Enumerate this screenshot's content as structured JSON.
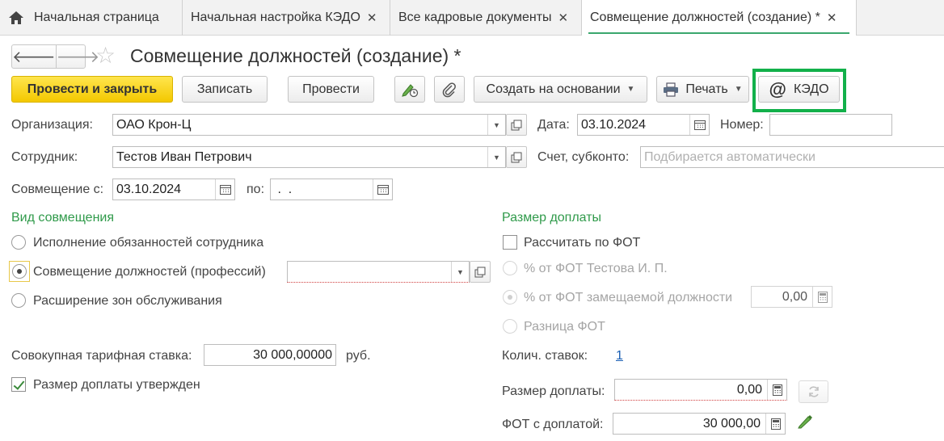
{
  "tabs": [
    {
      "label": "Начальная страница",
      "home": true
    },
    {
      "label": "Начальная настройка КЭДО"
    },
    {
      "label": "Все кадровые документы"
    },
    {
      "label": "Совмещение должностей (создание) *",
      "active": true
    }
  ],
  "header": {
    "title": "Совмещение должностей (создание) *"
  },
  "toolbar": {
    "post_close": "Провести и закрыть",
    "save": "Записать",
    "post": "Провести",
    "create_based": "Создать на основании",
    "print": "Печать",
    "kedo": "КЭДО"
  },
  "form": {
    "org_label": "Организация:",
    "org_value": "ОАО Крон-Ц",
    "date_label": "Дата:",
    "date_value": "03.10.2024",
    "number_label": "Номер:",
    "number_value": "",
    "employee_label": "Сотрудник:",
    "employee_value": "Тестов Иван Петрович",
    "account_label": "Счет, субконто:",
    "account_placeholder": "Подбирается автоматически",
    "from_label": "Совмещение с:",
    "from_value": "03.10.2024",
    "to_label": "по:",
    "to_value": " .  .",
    "kind_title": "Вид совмещения",
    "kind_options": [
      "Исполнение обязанностей сотрудника",
      "Совмещение должностей (профессий)",
      "Расширение зон обслуживания"
    ],
    "kind_selected": 1,
    "position_value": "",
    "rate_label": "Совокупная тарифная ставка:",
    "rate_value": "30 000,00000",
    "rate_unit": "руб.",
    "approved_label": "Размер доплаты утвержден",
    "approved": true,
    "pay_title": "Размер доплаты",
    "calc_fot_label": "Рассчитать по ФОТ",
    "calc_fot": false,
    "pay_options": [
      "% от ФОТ Тестова И. П.",
      "% от ФОТ замещаемой должности",
      "Разница ФОТ"
    ],
    "pay_selected": 1,
    "percent_value": "0,00",
    "stavok_label": "Колич. ставок:",
    "stavok_value": "1",
    "surcharge_label": "Размер доплаты:",
    "surcharge_value": "0,00",
    "fot_label": "ФОТ с доплатой:",
    "fot_value": "30 000,00"
  }
}
